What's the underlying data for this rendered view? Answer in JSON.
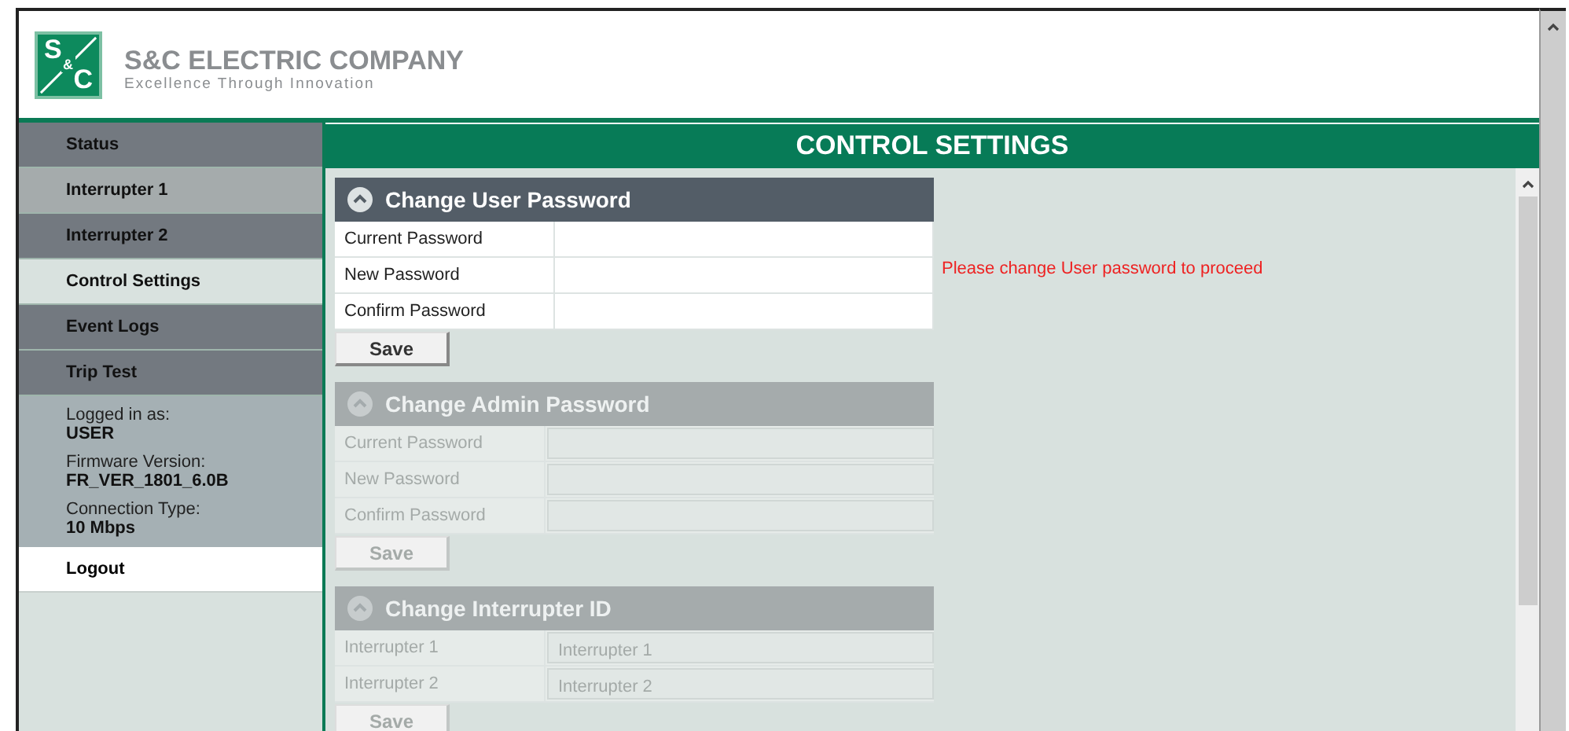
{
  "brand": {
    "logo_top": "S",
    "logo_amp": "&",
    "logo_bottom": "C",
    "name": "S&C ELECTRIC COMPANY",
    "tagline": "Excellence Through Innovation"
  },
  "sidebar": {
    "items": [
      {
        "label": "Status",
        "selected": false,
        "highlighted": false
      },
      {
        "label": "Interrupter 1",
        "selected": false,
        "highlighted": true
      },
      {
        "label": "Interrupter 2",
        "selected": false,
        "highlighted": false
      },
      {
        "label": "Control Settings",
        "selected": true,
        "highlighted": false
      },
      {
        "label": "Event Logs",
        "selected": false,
        "highlighted": false
      },
      {
        "label": "Trip Test",
        "selected": false,
        "highlighted": false
      }
    ],
    "info": [
      {
        "label": "Logged in as:",
        "value": "USER"
      },
      {
        "label": "Firmware Version:",
        "value": "FR_VER_1801_6.0B"
      },
      {
        "label": "Connection Type:",
        "value": "10 Mbps"
      }
    ],
    "logout": "Logout"
  },
  "page_title": "CONTROL SETTINGS",
  "sections": [
    {
      "title": "Change User Password",
      "enabled": true,
      "save": "Save",
      "rows": [
        {
          "label": "Current Password"
        },
        {
          "label": "New Password"
        },
        {
          "label": "Confirm Password"
        }
      ]
    },
    {
      "title": "Change Admin Password",
      "enabled": false,
      "save": "Save",
      "rows": [
        {
          "label": "Current Password"
        },
        {
          "label": "New Password"
        },
        {
          "label": "Confirm Password"
        }
      ]
    },
    {
      "title": "Change Interrupter ID",
      "enabled": false,
      "save": "Save",
      "rows": [
        {
          "label": "Interrupter 1",
          "value": "Interrupter 1"
        },
        {
          "label": "Interrupter 2",
          "value": "Interrupter 2"
        }
      ]
    }
  ],
  "message": "Please change User password to proceed"
}
